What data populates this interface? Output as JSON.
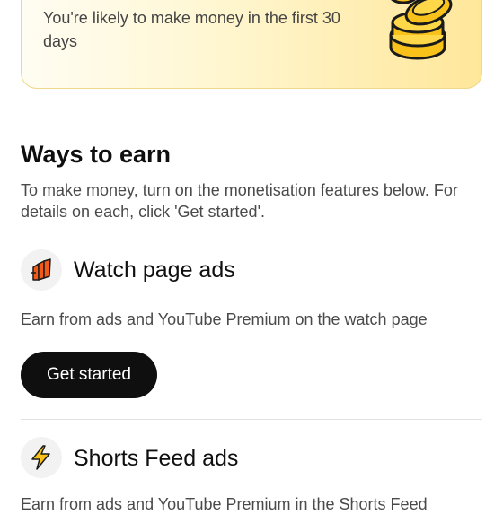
{
  "promo": {
    "text": "You're likely to make money in the first 30 days"
  },
  "ways_to_earn": {
    "title": "Ways to earn",
    "description": "To make money, turn on the monetisation features below. For details on each, click 'Get started'."
  },
  "features": [
    {
      "icon": "watch-page-ads-icon",
      "title": "Watch page ads",
      "description": "Earn from ads and YouTube Premium on the watch page",
      "button_label": "Get started"
    },
    {
      "icon": "lightning-bolt-icon",
      "title": "Shorts Feed ads",
      "description": "Earn from ads and YouTube Premium in the Shorts Feed"
    }
  ],
  "colors": {
    "accent_orange": "#f05a1a",
    "accent_yellow": "#f9c21a",
    "button_black": "#0f0f0f"
  }
}
